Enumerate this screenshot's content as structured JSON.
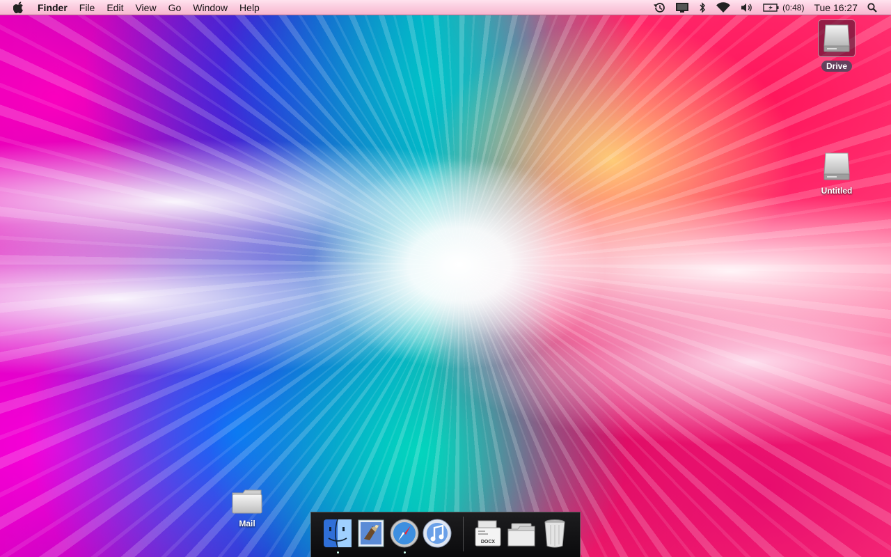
{
  "menubar": {
    "app_name": "Finder",
    "menus": [
      "File",
      "Edit",
      "View",
      "Go",
      "Window",
      "Help"
    ],
    "battery_time": "(0:48)",
    "clock": "Tue 16:27"
  },
  "status_icons": [
    "time-machine-icon",
    "display-icon",
    "bluetooth-icon",
    "wifi-icon",
    "volume-icon",
    "battery-icon",
    "spotlight-icon"
  ],
  "desktop": {
    "drive_label": "Drive",
    "untitled_label": "Untitled",
    "mail_label": "Mail"
  },
  "dock": {
    "apps": [
      "finder-icon",
      "mail-app-icon",
      "safari-icon",
      "itunes-icon"
    ],
    "docs": [
      "docx-document-icon",
      "folder-stack-icon",
      "trash-icon"
    ],
    "docx_text": "DOCX"
  }
}
